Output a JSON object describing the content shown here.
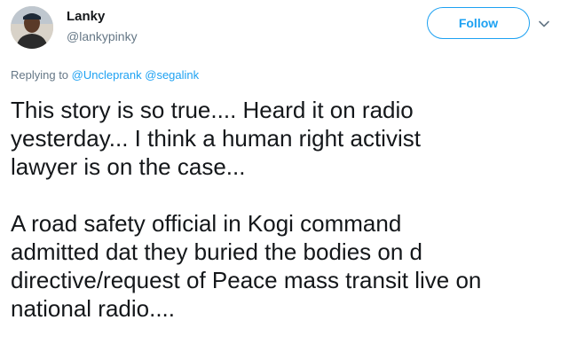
{
  "user": {
    "display_name": "Lanky",
    "handle": "@lankypinky"
  },
  "follow_button": {
    "label": "Follow"
  },
  "reply_context": {
    "prefix": "Replying to",
    "mentions": [
      "@Uncleprank",
      "@segalink"
    ]
  },
  "tweet": {
    "paragraphs": [
      "This story is so true.... Heard it on radio\nyesterday... I think a human right activist\nlawyer is on the case...",
      "A road safety official in Kogi command\nadmitted dat they buried the bodies on d\ndirective/request of Peace mass transit live on\nnational radio...."
    ]
  },
  "icons": {
    "avatar": "user-avatar",
    "menu": "chevron-down-icon"
  },
  "colors": {
    "accent": "#1da1f2",
    "text": "#14171a",
    "muted": "#657786"
  }
}
